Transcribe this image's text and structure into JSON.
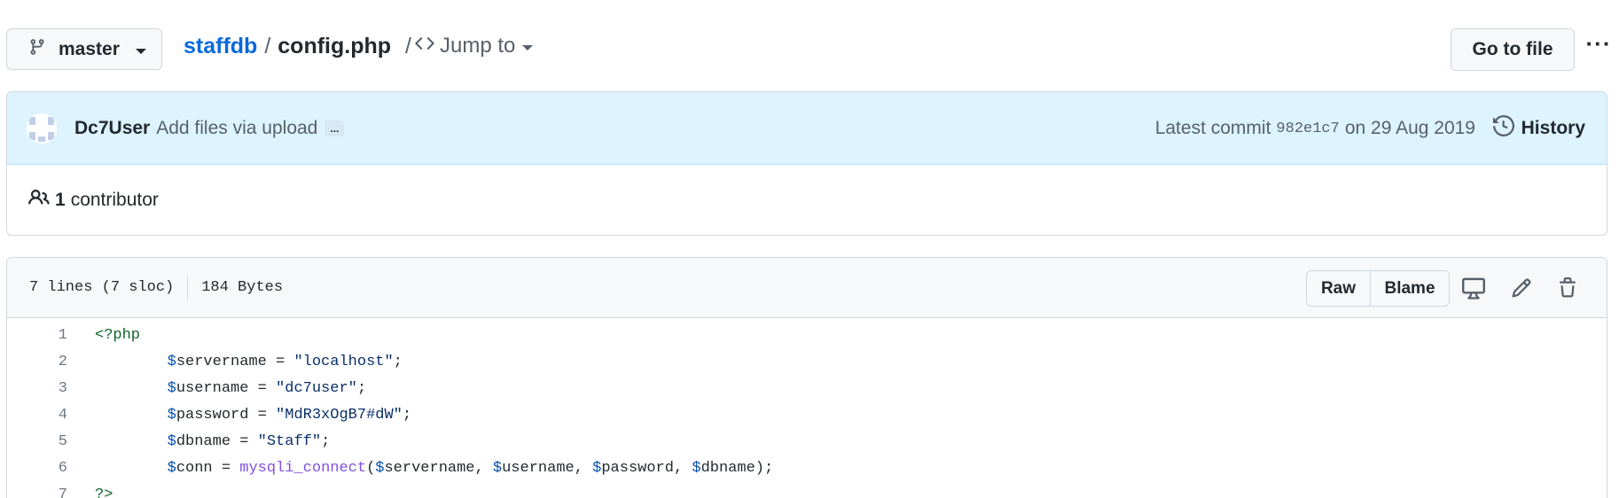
{
  "branch": {
    "label": "master",
    "icon": "git-branch-icon"
  },
  "breadcrumb": {
    "repo": "staffdb",
    "separator": "/",
    "file": "config.php",
    "jump_separator": "/",
    "jump_label": "Jump to"
  },
  "actions": {
    "go_to_file": "Go to file",
    "more": "···"
  },
  "commit": {
    "author": "Dc7User",
    "message": "Add files via upload",
    "ellipsis": "...",
    "latest_label": "Latest commit",
    "sha": "982e1c7",
    "date_text": "on 29 Aug 2019",
    "history_label": "History"
  },
  "contributors": {
    "count": "1",
    "label": "contributor"
  },
  "file": {
    "lines_info": "7 lines (7 sloc)",
    "size": "184 Bytes",
    "raw_label": "Raw",
    "blame_label": "Blame"
  },
  "code_lines": [
    {
      "n": "1",
      "tokens": [
        {
          "t": "<?php",
          "c": "tag"
        }
      ]
    },
    {
      "n": "2",
      "tokens": [
        {
          "t": "\t",
          "c": ""
        },
        {
          "t": "$",
          "c": "var"
        },
        {
          "t": "servername = ",
          "c": ""
        },
        {
          "t": "\"localhost\"",
          "c": "str"
        },
        {
          "t": ";",
          "c": ""
        }
      ]
    },
    {
      "n": "3",
      "tokens": [
        {
          "t": "\t",
          "c": ""
        },
        {
          "t": "$",
          "c": "var"
        },
        {
          "t": "username = ",
          "c": ""
        },
        {
          "t": "\"dc7user\"",
          "c": "str"
        },
        {
          "t": ";",
          "c": ""
        }
      ]
    },
    {
      "n": "4",
      "tokens": [
        {
          "t": "\t",
          "c": ""
        },
        {
          "t": "$",
          "c": "var"
        },
        {
          "t": "password = ",
          "c": ""
        },
        {
          "t": "\"MdR3xOgB7#dW\"",
          "c": "str"
        },
        {
          "t": ";",
          "c": ""
        }
      ]
    },
    {
      "n": "5",
      "tokens": [
        {
          "t": "\t",
          "c": ""
        },
        {
          "t": "$",
          "c": "var"
        },
        {
          "t": "dbname = ",
          "c": ""
        },
        {
          "t": "\"Staff\"",
          "c": "str"
        },
        {
          "t": ";",
          "c": ""
        }
      ]
    },
    {
      "n": "6",
      "tokens": [
        {
          "t": "\t",
          "c": ""
        },
        {
          "t": "$",
          "c": "var"
        },
        {
          "t": "conn = ",
          "c": ""
        },
        {
          "t": "mysqli_connect",
          "c": "fn"
        },
        {
          "t": "(",
          "c": ""
        },
        {
          "t": "$",
          "c": "var"
        },
        {
          "t": "servername, ",
          "c": ""
        },
        {
          "t": "$",
          "c": "var"
        },
        {
          "t": "username, ",
          "c": ""
        },
        {
          "t": "$",
          "c": "var"
        },
        {
          "t": "password, ",
          "c": ""
        },
        {
          "t": "$",
          "c": "var"
        },
        {
          "t": "dbname);",
          "c": ""
        }
      ]
    },
    {
      "n": "7",
      "tokens": [
        {
          "t": "?>",
          "c": "tag"
        }
      ]
    }
  ],
  "colors": {
    "link": "#0969da",
    "commit_bg": "#ddf4ff",
    "header_bg": "#f6f8fa",
    "border": "#d0d7de"
  }
}
